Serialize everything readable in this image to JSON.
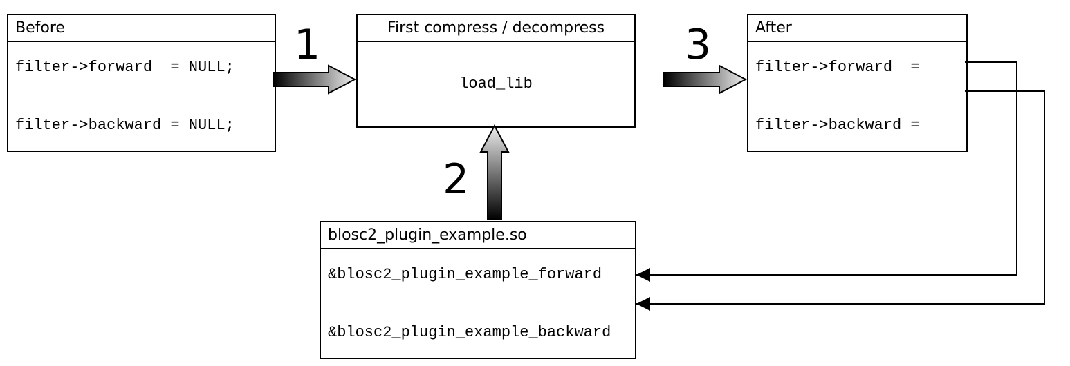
{
  "before": {
    "title": "Before",
    "line1": "filter->forward  = NULL;",
    "line2": "filter->backward = NULL;"
  },
  "compress": {
    "title": "First compress / decompress",
    "body": "load_lib"
  },
  "after": {
    "title": "After",
    "line1": "filter->forward  =",
    "line2": "filter->backward ="
  },
  "plugin": {
    "title": "blosc2_plugin_example.so",
    "line1": "&blosc2_plugin_example_forward",
    "line2": "&blosc2_plugin_example_backward"
  },
  "steps": {
    "one": "1",
    "two": "2",
    "three": "3"
  }
}
